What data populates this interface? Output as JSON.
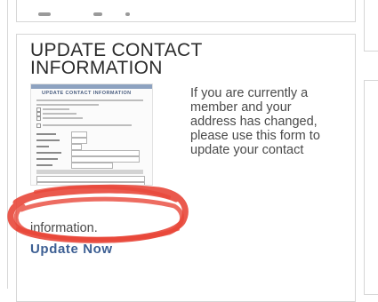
{
  "widget": {
    "title": "UPDATE CONTACT INFORMATION",
    "description": "If you are currently a member and your address has changed, please use this form to update your contact",
    "description_tail": "information.",
    "link_label": "Update Now"
  },
  "thumbnail": {
    "title": "UPDATE CONTACT INFORMATION"
  },
  "colors": {
    "link": "#3d5f93",
    "highlight_scribble": "#e8473a",
    "title": "#2b2b2b"
  }
}
